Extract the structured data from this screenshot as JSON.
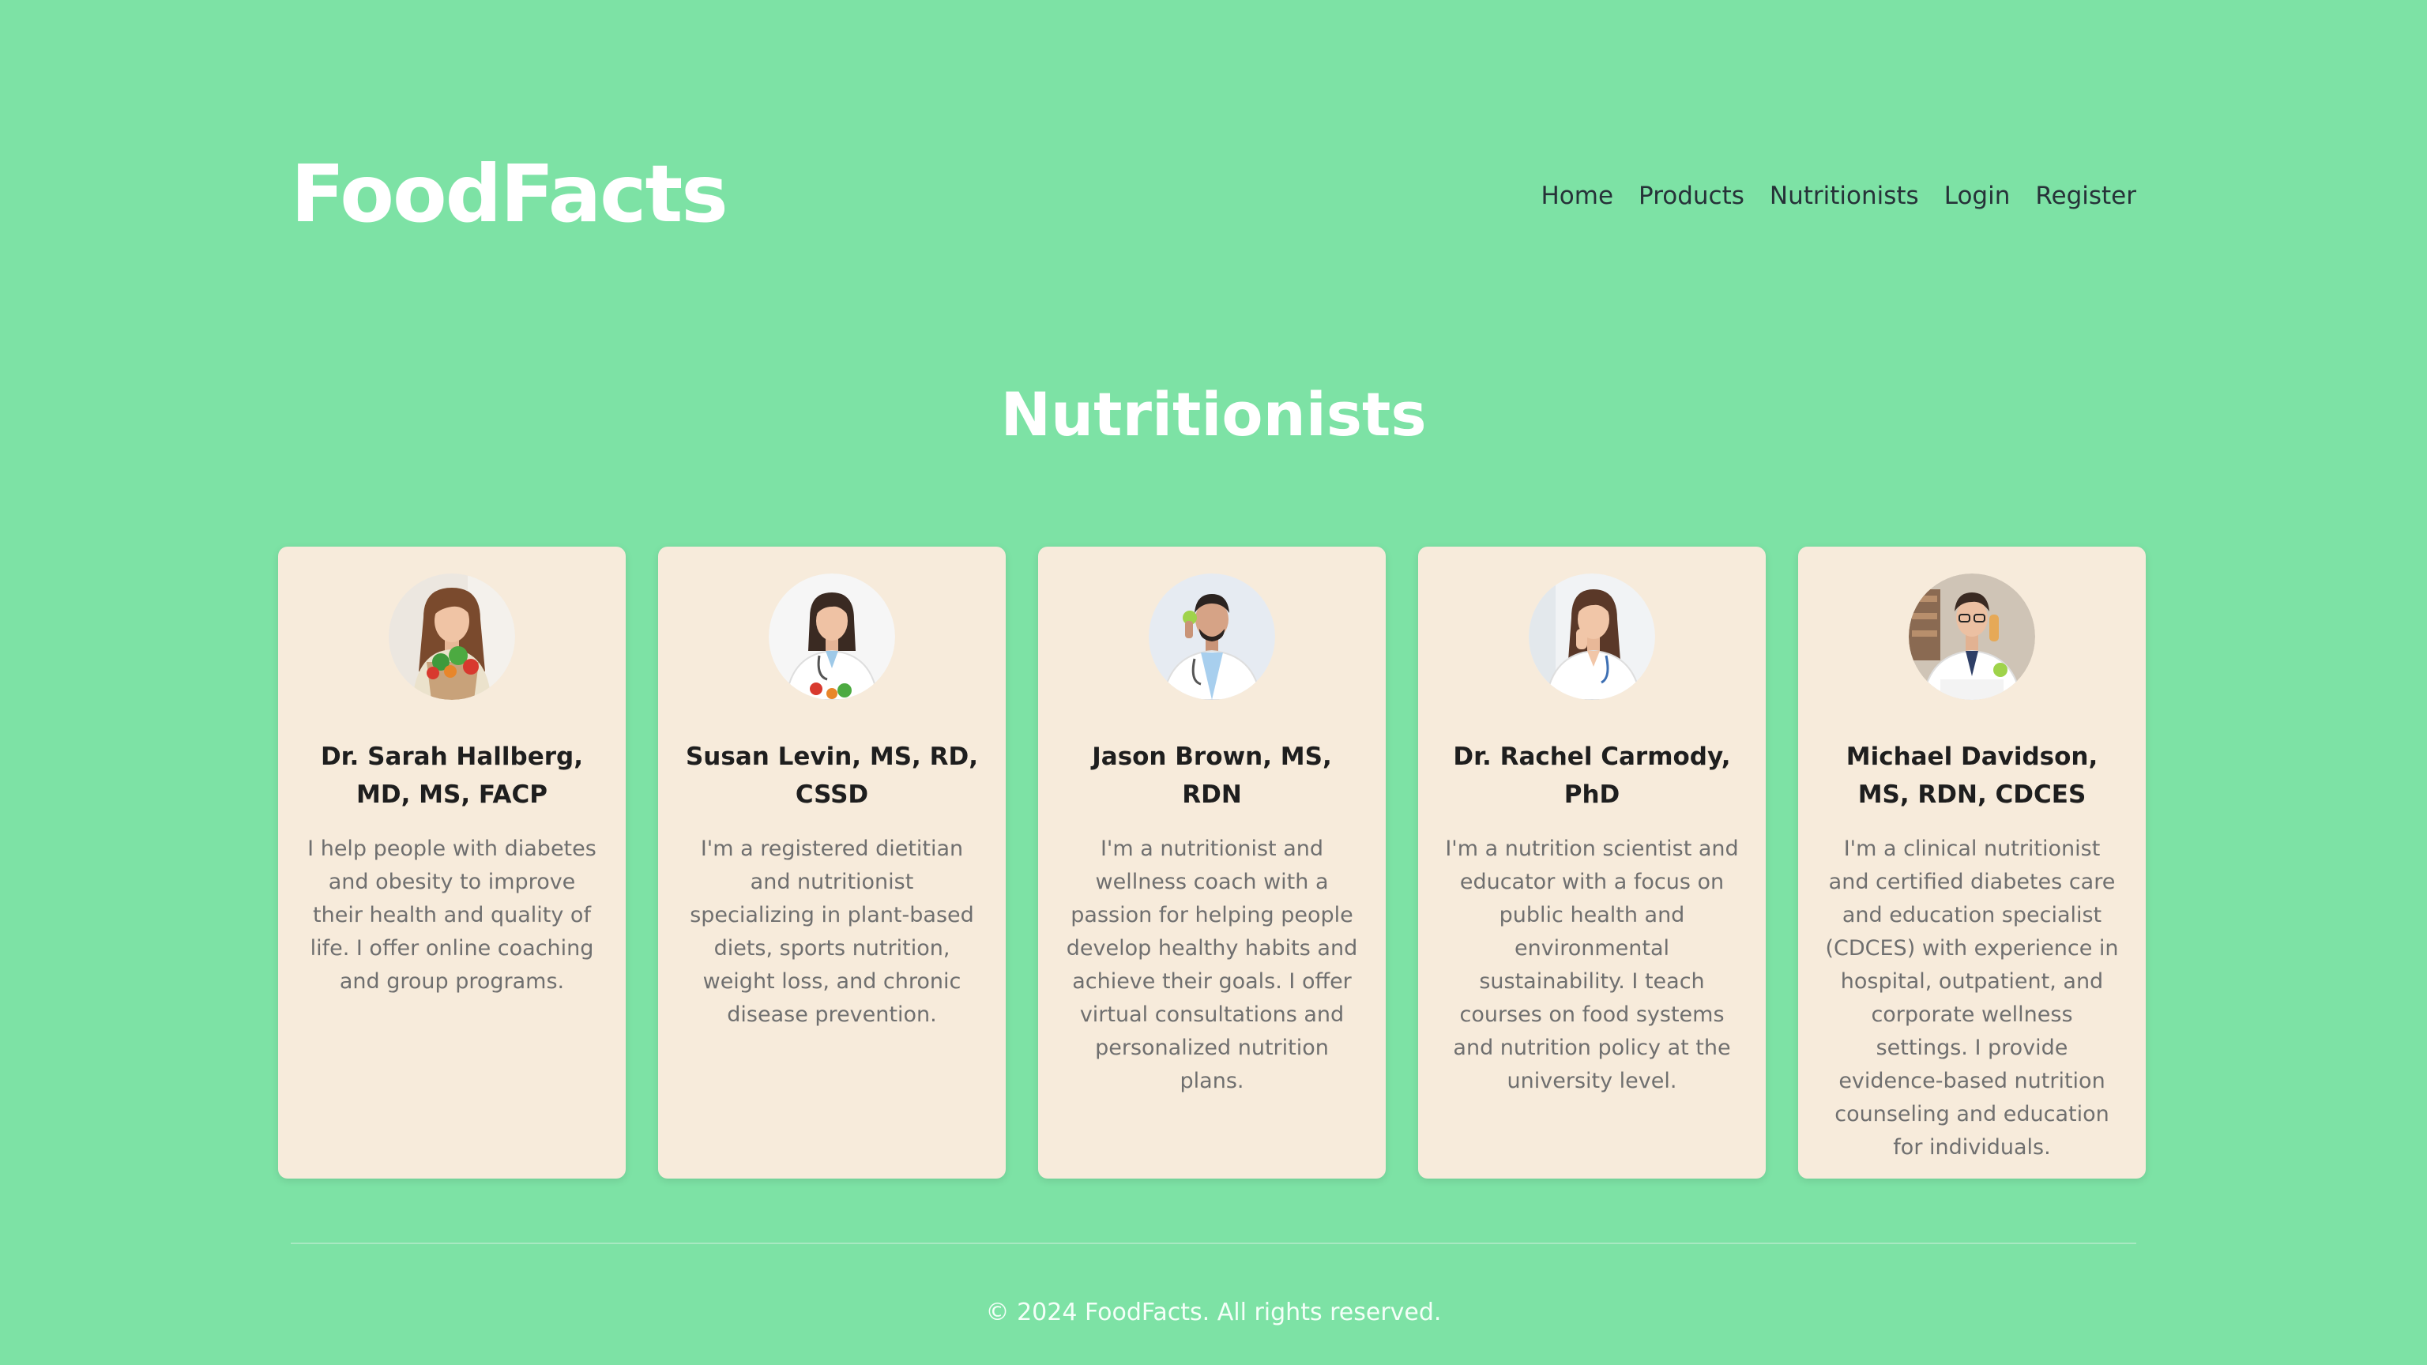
{
  "header": {
    "logo": "FoodFacts",
    "nav": [
      "Home",
      "Products",
      "Nutritionists",
      "Login",
      "Register"
    ]
  },
  "main": {
    "title": "Nutritionists",
    "cards": [
      {
        "name": "Dr. Sarah Hallberg, MD, MS, FACP",
        "bio": "I help people with diabetes and obesity to improve their health and quality of life. I offer online coaching and group programs."
      },
      {
        "name": "Susan Levin, MS, RD, CSSD",
        "bio": "I'm a registered dietitian and nutritionist specializing in plant-based diets, sports nutrition, weight loss, and chronic disease prevention."
      },
      {
        "name": "Jason Brown, MS, RDN",
        "bio": "I'm a nutritionist and wellness coach with a passion for helping people develop healthy habits and achieve their goals. I offer virtual consultations and personalized nutrition plans."
      },
      {
        "name": "Dr. Rachel Carmody, PhD",
        "bio": "I'm a nutrition scientist and educator with a focus on public health and environmental sustainability. I teach courses on food systems and nutrition policy at the university level."
      },
      {
        "name": "Michael Davidson, MS, RDN, CDCES",
        "bio": "I'm a clinical nutritionist and certified diabetes care and education specialist (CDCES) with experience in hospital, outpatient, and corporate wellness settings. I provide evidence-based nutrition counseling and education for individuals."
      }
    ]
  },
  "footer": {
    "copyright": "© 2024 FoodFacts. All rights reserved."
  },
  "colors": {
    "background": "#7de2a5",
    "card": "#f7ebdb",
    "logo": "#ffffff",
    "nav_text": "#263238"
  }
}
